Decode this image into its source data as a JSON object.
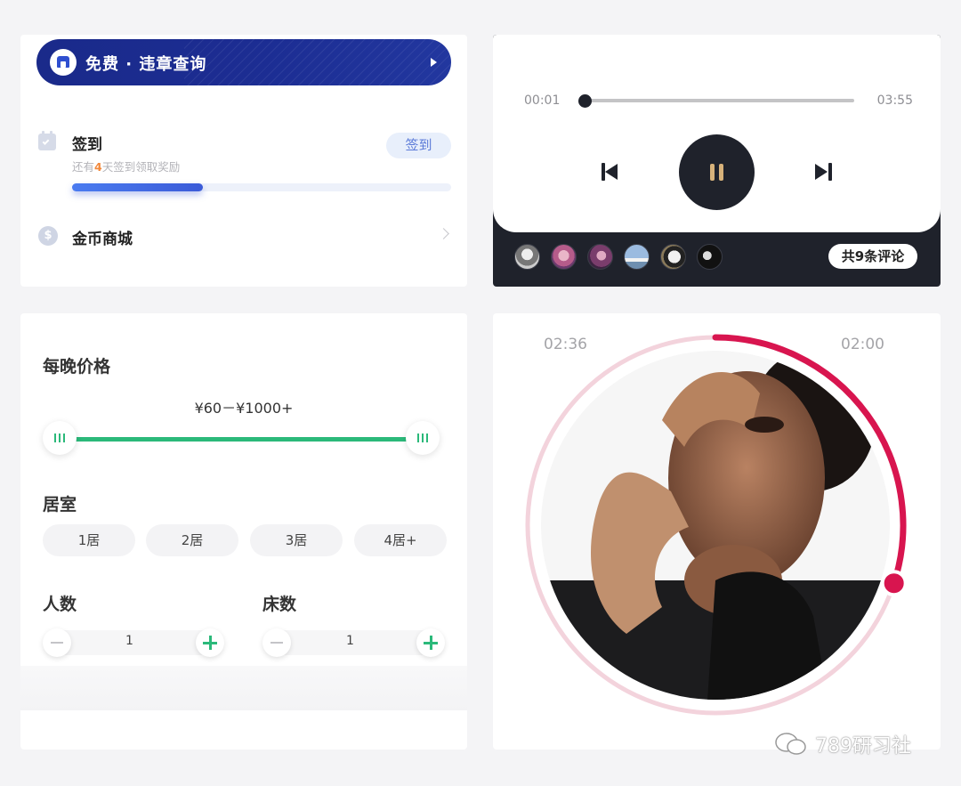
{
  "checkin_card": {
    "banner_text": "免费 · 违章查询",
    "checkin_title": "签到",
    "checkin_sub_prefix": "还有",
    "checkin_sub_days": "4",
    "checkin_sub_suffix": "天签到领取奖励",
    "checkin_button": "签到",
    "progress_fraction": 0.345,
    "coin_symbol": "$",
    "store_label": "金币商城"
  },
  "player_card": {
    "time_elapsed": "00:01",
    "time_total": "03:55",
    "progress_fraction": 0.0,
    "comment_label": "共9条评论"
  },
  "filter_card": {
    "price_title": "每晚价格",
    "price_range": "¥60－¥1000+",
    "rooms_title": "居室",
    "rooms": [
      "1居",
      "2居",
      "3居",
      "4居+"
    ],
    "people_title": "人数",
    "people_value": "1",
    "beds_title": "床数",
    "beds_value": "1"
  },
  "circle_card": {
    "time_left": "02:36",
    "time_right": "02:00",
    "progress_fraction": 0.3
  },
  "watermark": {
    "text": "789研习社"
  },
  "colors": {
    "accent_green": "#2bb97a",
    "accent_red": "#d8154f",
    "banner_blue": "#1c2d93",
    "dark": "#1f222b"
  }
}
